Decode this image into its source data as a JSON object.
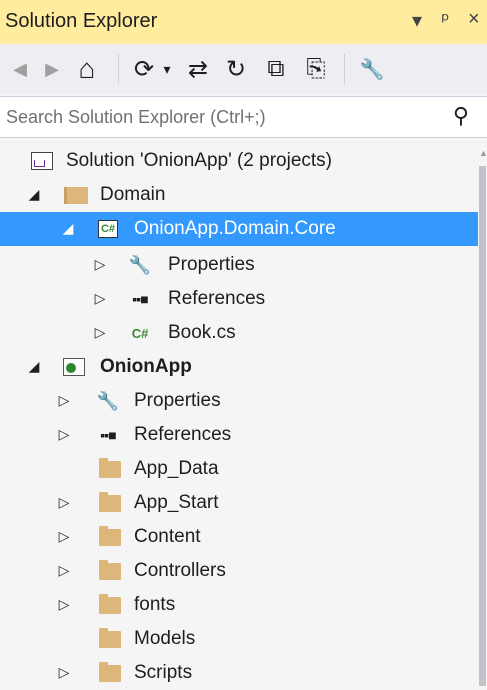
{
  "panel": {
    "title": "Solution Explorer",
    "controls": {
      "dropdown": "▾",
      "pin": "ᵖ",
      "close": "×"
    }
  },
  "toolbar": {
    "back": "◀",
    "forward": "▶",
    "home": "⌂",
    "pending_changes": "⟳",
    "pending_dropdown": "▾",
    "sync": "⇄",
    "refresh": "↻",
    "collapse_all": "⧉",
    "show_all_files": "⎘",
    "properties": "🔧"
  },
  "search": {
    "placeholder": "Search Solution Explorer (Ctrl+;)",
    "icon": "⚲"
  },
  "tree": {
    "solution": "Solution 'OnionApp' (2 projects)",
    "domain_folder": "Domain",
    "domain_core": "OnionApp.Domain.Core",
    "core_properties": "Properties",
    "core_references": "References",
    "core_book": "Book.cs",
    "onionapp": "OnionApp",
    "app_properties": "Properties",
    "app_references": "References",
    "app_data": "App_Data",
    "app_start": "App_Start",
    "content": "Content",
    "controllers": "Controllers",
    "fonts": "fonts",
    "models": "Models",
    "scripts": "Scripts"
  },
  "glyphs": {
    "expanded": "◢",
    "collapsed": "▷",
    "cs_badge": "C#",
    "refs": "▪▪■"
  },
  "colors": {
    "title_bg": "#ffec9e",
    "selection": "#3399ff",
    "folder": "#dcb67a"
  }
}
